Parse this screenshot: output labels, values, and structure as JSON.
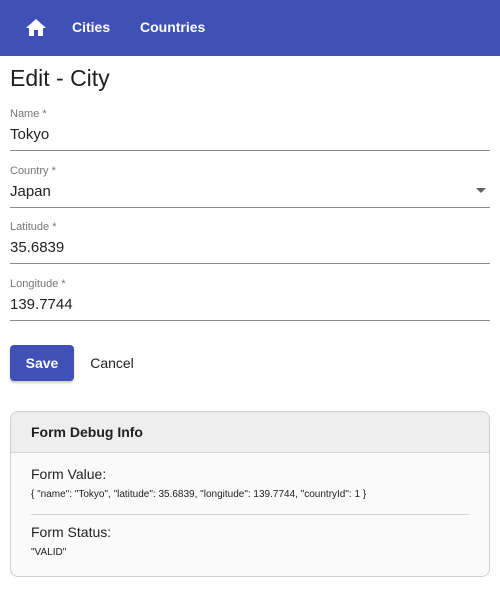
{
  "nav": {
    "home_icon": "home-icon",
    "cities_label": "Cities",
    "countries_label": "Countries"
  },
  "page": {
    "title": "Edit - City"
  },
  "form": {
    "name": {
      "label": "Name *",
      "value": "Tokyo"
    },
    "country": {
      "label": "Country *",
      "value": "Japan"
    },
    "latitude": {
      "label": "Latitude *",
      "value": "35.6839"
    },
    "longitude": {
      "label": "Longitude *",
      "value": "139.7744"
    },
    "save_label": "Save",
    "cancel_label": "Cancel"
  },
  "debug": {
    "title": "Form Debug Info",
    "value_label": "Form Value:",
    "value_json": "{ \"name\": \"Tokyo\", \"latitude\": 35.6839, \"longitude\": 139.7744, \"countryId\": 1 }",
    "status_label": "Form Status:",
    "status_value": "\"VALID\""
  },
  "colors": {
    "primary": "#3f51b5",
    "toolbar_text": "#ffffff"
  }
}
